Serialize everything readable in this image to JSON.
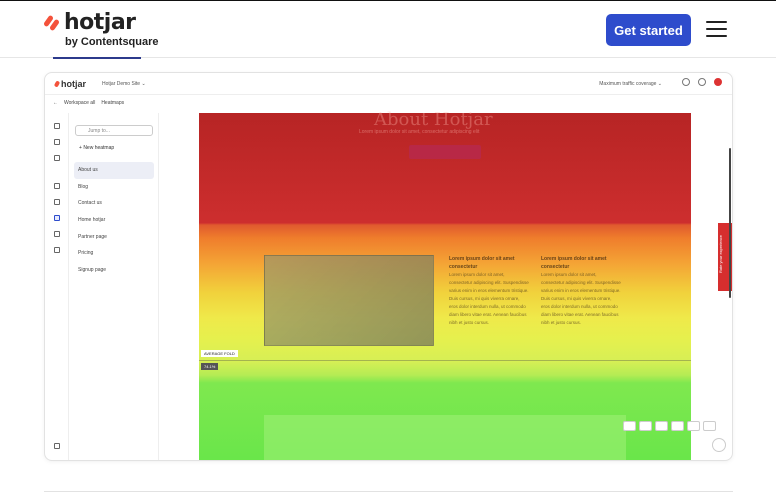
{
  "header": {
    "logo_word": "hotjar",
    "logo_sub": "by Contentsquare",
    "cta_label": "Get started",
    "cta_color": "#2e4ccc",
    "brand_color": "#f4523b",
    "menu_icon": "hamburger-icon"
  },
  "app": {
    "logo_word": "hotjar",
    "site_select": "Hotjar Demo Site ⌄",
    "coverage": "Maximum traffic coverage ⌄",
    "breadcrumb": [
      "←",
      "Workspace all",
      "Heatmaps"
    ],
    "search_placeholder": "Jump to...",
    "new_heatmap": "New heatmap",
    "pages": [
      "About us",
      "Blog",
      "Contact us",
      "Home hotjar",
      "Partner page",
      "Pricing",
      "Signup page"
    ],
    "selected_page": "About us"
  },
  "heatmap": {
    "hero_title": "About Hotjar",
    "hero_sub": "Lorem ipsum dolor sit amet, consectetur adipiscing elit",
    "col1_title": "Lorem ipsum dolor sit amet consectetur",
    "col1_body": "Lorem ipsum dolor sit amet, consectetur adipiscing elit. Suspendisse varius enim in eros elementum tristique. Duis cursus, mi quis viverra ornare, eros dolor interdum nulla, ut commodo diam libero vitae erat. Aenean faucibus nibh et justo cursus.",
    "col2_title": "Lorem ipsum dolor sit amet consectetur",
    "col2_body": "Lorem ipsum dolor sit amet, consectetur adipiscing elit. Suspendisse varius enim in eros elementum tristique. Duis cursus, mi quis viverra ornare, eros dolor interdum nulla, ut commodo diam libero vitae erat. Aenean faucibus nibh et justo cursus.",
    "fold_label": "AVERAGE FOLD",
    "fold_pct": "74.1%",
    "feedback_label": "Rate your experience"
  }
}
